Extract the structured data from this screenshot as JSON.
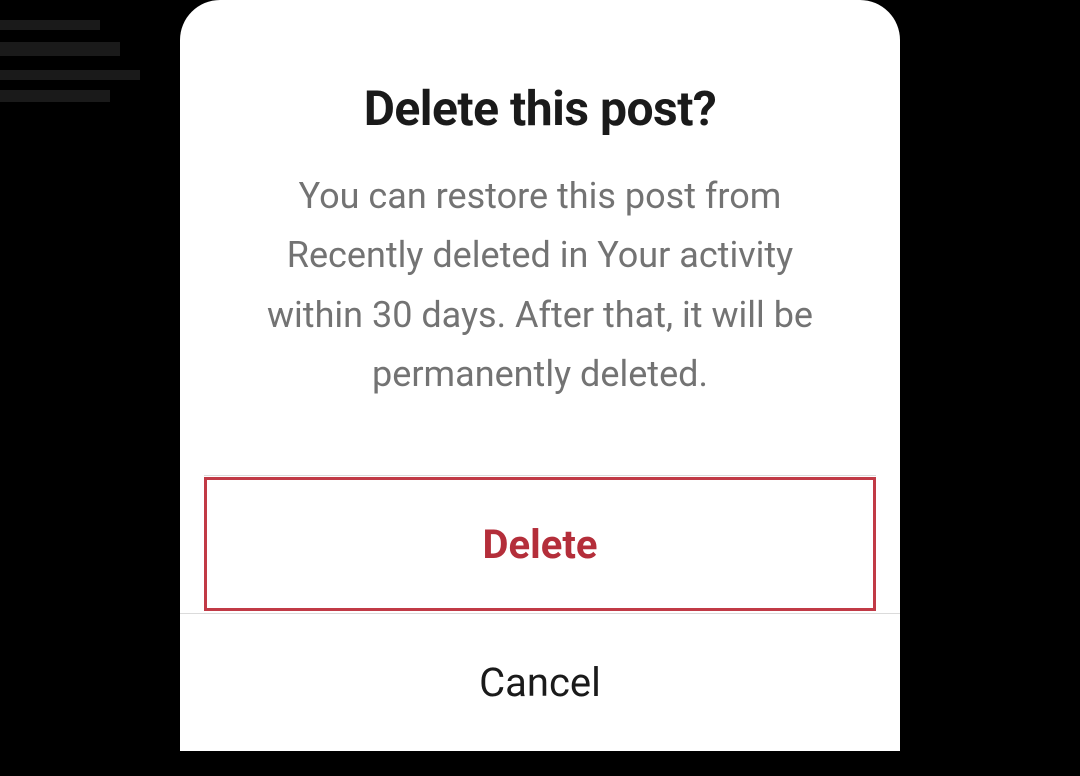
{
  "modal": {
    "title": "Delete this post?",
    "description": "You can restore this post from Recently deleted in Your activity within 30 days. After that, it will be permanently deleted.",
    "delete_label": "Delete",
    "cancel_label": "Cancel"
  },
  "colors": {
    "destructive": "#b42e3a",
    "text_primary": "#1a1a1a",
    "text_secondary": "#737373",
    "highlight_border": "#c13a46"
  }
}
